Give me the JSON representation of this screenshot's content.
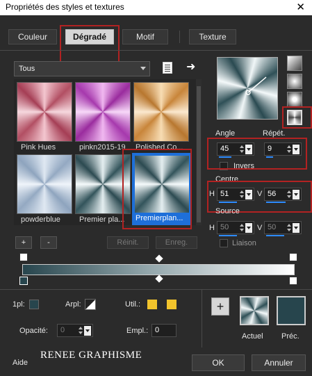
{
  "window": {
    "title": "Propriétés des styles et textures",
    "close_glyph": "✕"
  },
  "tabs": [
    {
      "label": "Couleur"
    },
    {
      "label": "Dégradé"
    },
    {
      "label": "Motif"
    },
    {
      "label": "Texture"
    }
  ],
  "library": {
    "category": "Tous",
    "items": [
      {
        "label": "Pink Hues"
      },
      {
        "label": "pinkn2015-19"
      },
      {
        "label": "Polished Co..."
      },
      {
        "label": "powderblue"
      },
      {
        "label": "Premier pla..."
      },
      {
        "label": "Premierplan..."
      }
    ],
    "add_label": "+",
    "remove_label": "-",
    "reset_label": "Réinit.",
    "save_label": "Enreg."
  },
  "gradient": {
    "angle_label": "Angle",
    "angle_value": "45",
    "repeat_label": "Répét.",
    "repeat_value": "9",
    "invert_label": "Invers",
    "center_label": "Centre",
    "center_h_label": "H",
    "center_h_value": "51",
    "center_v_label": "V",
    "center_v_value": "56",
    "source_label": "Source",
    "source_h_label": "H",
    "source_h_value": "50",
    "source_v_label": "V",
    "source_v_value": "50",
    "link_label": "Liaison"
  },
  "bottom": {
    "pl_label": "1pl:",
    "arpl_label": "Arpl:",
    "util_label": "Util.:",
    "opacity_label": "Opacité:",
    "opacity_value": "0",
    "empl_label": "Empl.:",
    "empl_value": "0",
    "current_label": "Actuel",
    "previous_label": "Préc.",
    "add_label": "+"
  },
  "footer": {
    "help_label": "Aide",
    "watermark": "RENEE GRAPHISME",
    "ok_label": "OK",
    "cancel_label": "Annuler"
  },
  "colors": {
    "accent": "#2d8cff",
    "selection": "#1e6fd9",
    "red_box": "#b22222",
    "teal_dark": "#27454d",
    "yellow": "#f2c42c"
  }
}
